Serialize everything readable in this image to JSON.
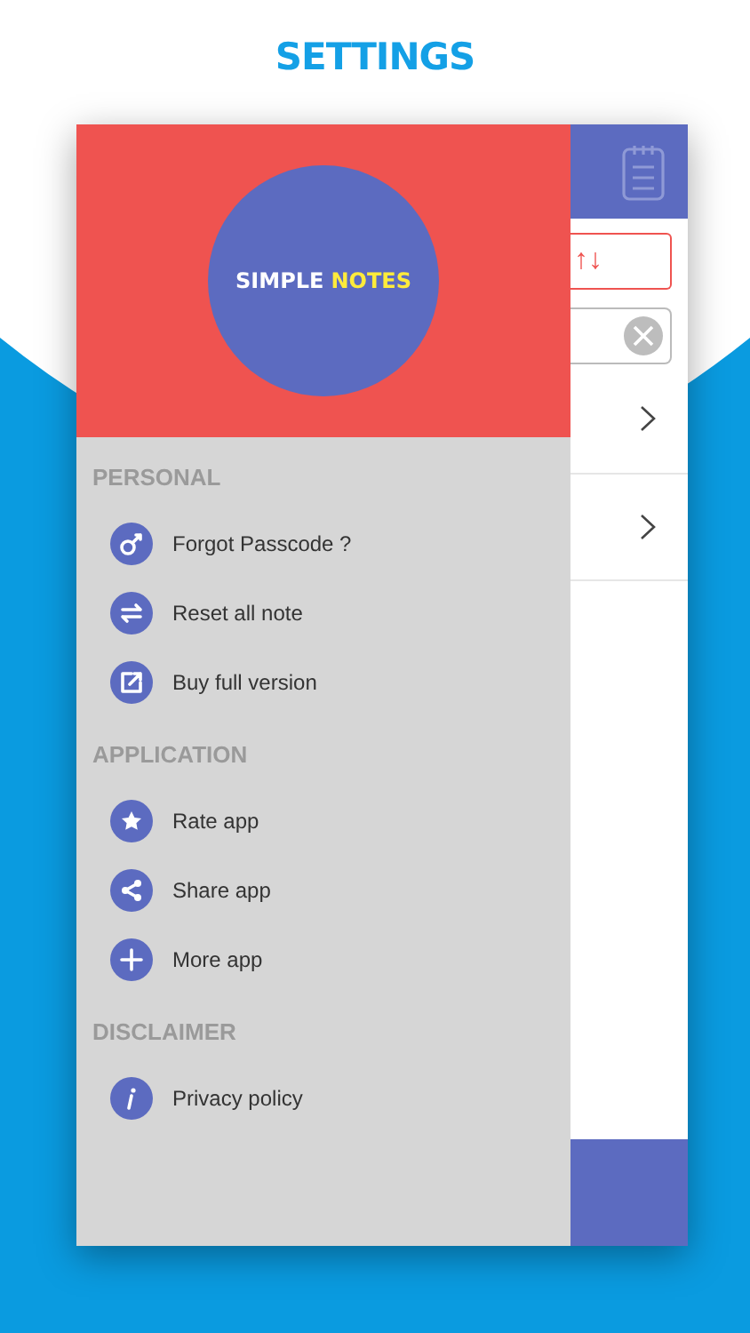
{
  "page_title": "SETTINGS",
  "drawer": {
    "logo": {
      "first_word": "SIMPLE",
      "second_word": "NOTES"
    },
    "sections": [
      {
        "title": "PERSONAL",
        "items": [
          {
            "label": "Forgot Passcode ?"
          },
          {
            "label": "Reset all note"
          },
          {
            "label": "Buy full version"
          }
        ]
      },
      {
        "title": "APPLICATION",
        "items": [
          {
            "label": "Rate app"
          },
          {
            "label": "Share app"
          },
          {
            "label": "More app"
          }
        ]
      },
      {
        "title": "DISCLAIMER",
        "items": [
          {
            "label": "Privacy policy"
          }
        ]
      }
    ]
  },
  "main": {
    "sort_button": "↑↓"
  }
}
